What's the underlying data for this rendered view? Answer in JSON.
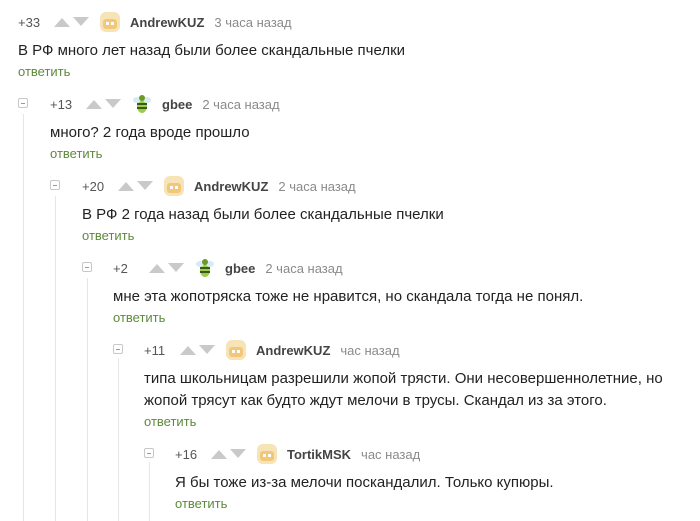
{
  "comments": [
    {
      "rating": "+33",
      "author": "AndrewKUZ",
      "time": "3 часа назад",
      "text": "В РФ много лет назад были более скандальные пчелки",
      "reply": "ответить",
      "avatar_icon": "andrewkuz-avatar"
    },
    {
      "rating": "+13",
      "author": "gbee",
      "time": "2 часа назад",
      "text": "много? 2 года вроде прошло",
      "reply": "ответить",
      "avatar_icon": "gbee-avatar"
    },
    {
      "rating": "+20",
      "author": "AndrewKUZ",
      "time": "2 часа назад",
      "text": "В РФ 2 года назад были более скандальные пчелки",
      "reply": "ответить",
      "avatar_icon": "andrewkuz-avatar"
    },
    {
      "rating": "+2",
      "author": "gbee",
      "time": "2 часа назад",
      "text": "мне эта жопотряска тоже не нравится, но скандала тогда не понял.",
      "reply": "ответить",
      "avatar_icon": "gbee-avatar"
    },
    {
      "rating": "+11",
      "author": "AndrewKUZ",
      "time": "час назад",
      "text_lines": [
        "типа школьницам разрешили жопой трясти. Они несовершеннолетние, но",
        "жопой трясут как будто ждут мелочи в трусы. Скандал из за этого."
      ],
      "reply": "ответить",
      "avatar_icon": "andrewkuz-avatar"
    },
    {
      "rating": "+16",
      "author": "TortikMSK",
      "time": "час назад",
      "text": "Я бы тоже из-за мелочи поскандалил. Только купюры.",
      "reply": "ответить",
      "avatar_icon": "tortikmsk-avatar"
    }
  ],
  "colors": {
    "reply_link": "#5c8a3a",
    "author": "#444444",
    "time": "#8a8a8a",
    "text": "#222222",
    "vote_arrow": "#c9c9c9",
    "thread_line": "#e6e6e6"
  }
}
